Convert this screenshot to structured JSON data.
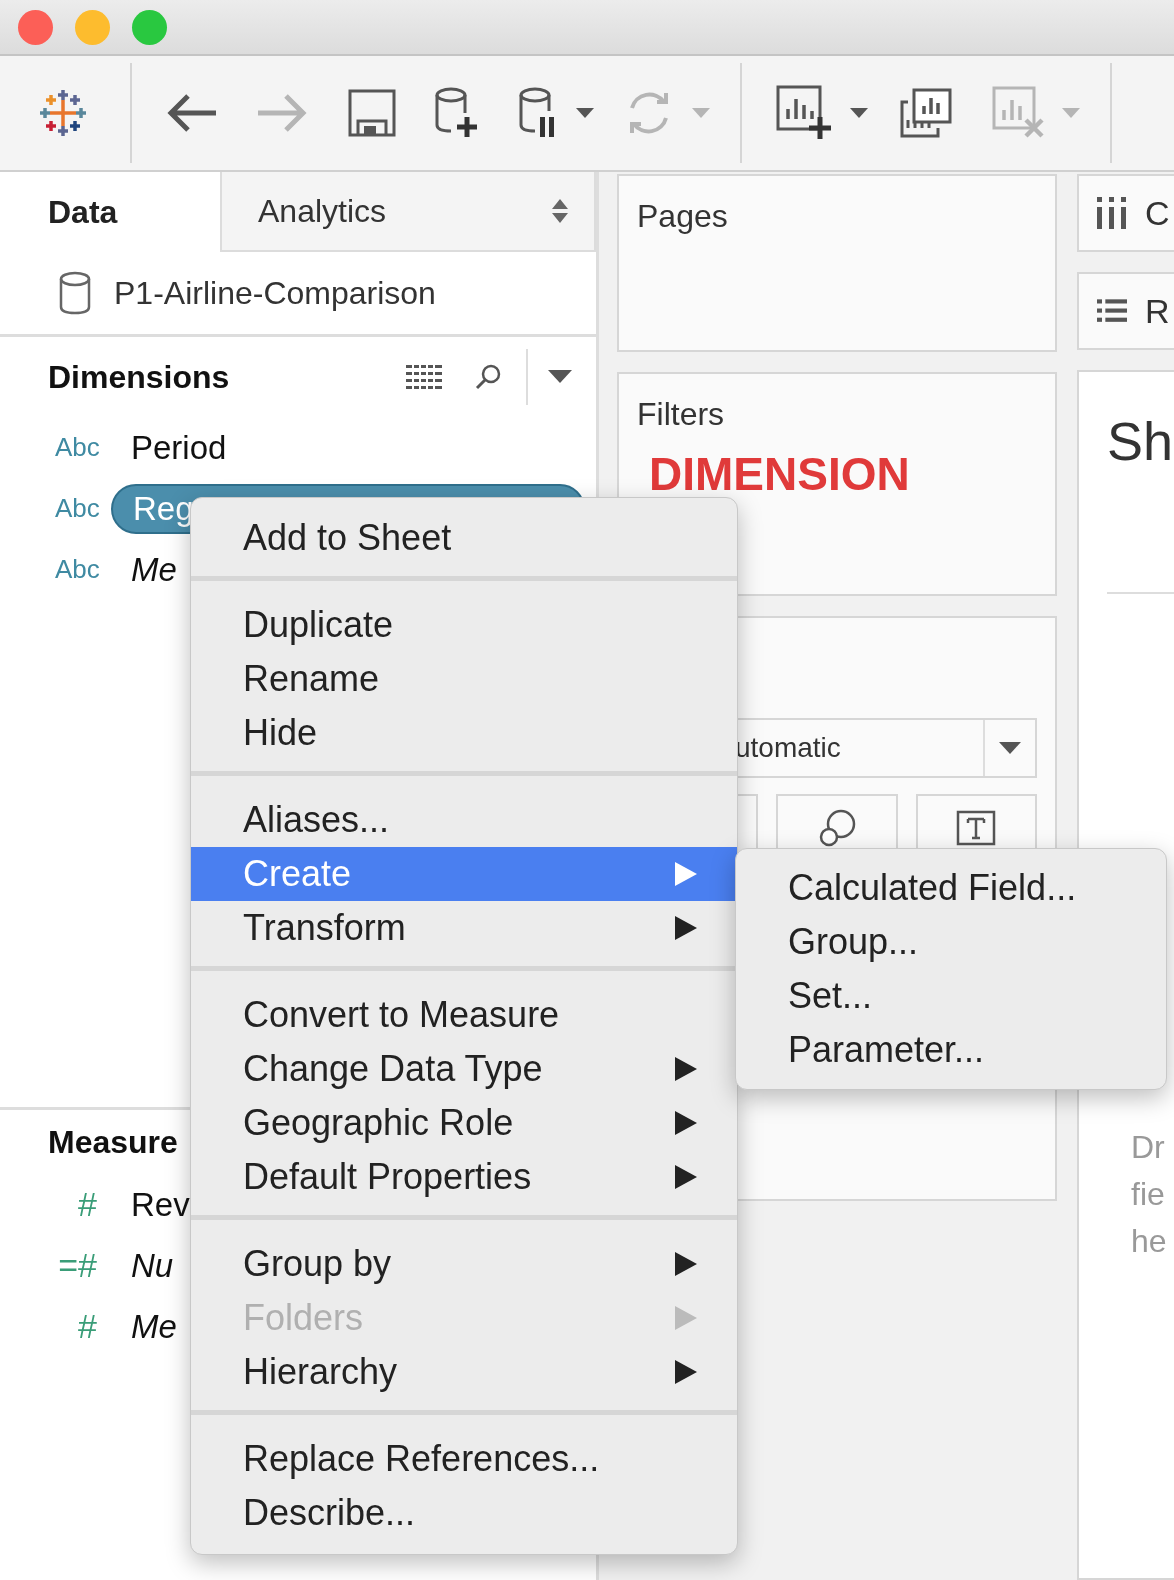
{
  "toolbar": [
    {
      "kind": "logo"
    },
    {
      "kind": "divider"
    },
    {
      "kind": "back",
      "disabled": false
    },
    {
      "kind": "forward",
      "disabled": true
    },
    {
      "kind": "save",
      "disabled": false
    },
    {
      "kind": "new-source",
      "disabled": false
    },
    {
      "kind": "pause-source",
      "disabled": false
    },
    {
      "kind": "caret",
      "disabled": false
    },
    {
      "kind": "refresh",
      "disabled": true
    },
    {
      "kind": "caret",
      "disabled": true
    },
    {
      "kind": "divider"
    },
    {
      "kind": "new-sheet",
      "disabled": false
    },
    {
      "kind": "caret",
      "disabled": false
    },
    {
      "kind": "duplicate-sheet",
      "disabled": false
    },
    {
      "kind": "clear-sheet",
      "disabled": true
    },
    {
      "kind": "caret",
      "disabled": true
    },
    {
      "kind": "divider"
    }
  ],
  "tabs": [
    {
      "label": "Data",
      "selected": true
    },
    {
      "label": "Analytics",
      "selected": false
    }
  ],
  "data_source": "P1-Airline-Comparison",
  "dimensions": {
    "title": "Dimensions",
    "fields": [
      {
        "type_label": "Abc",
        "kind": "text",
        "name": "Period",
        "italic": false,
        "selected": false
      },
      {
        "type_label": "Abc",
        "kind": "text",
        "name": "Reg",
        "italic": false,
        "selected": true
      },
      {
        "type_label": "Abc",
        "kind": "text",
        "name": "Me",
        "italic": true,
        "selected": false
      }
    ]
  },
  "measures": {
    "title": "Measure",
    "fields": [
      {
        "type_label": "#",
        "kind": "number",
        "name": "Rev",
        "italic": false,
        "selected": false
      },
      {
        "type_label": "=#",
        "kind": "number",
        "name": "Nu",
        "italic": true,
        "selected": false
      },
      {
        "type_label": "#",
        "kind": "number",
        "name": "Me",
        "italic": true,
        "selected": false
      }
    ]
  },
  "shelves": {
    "pages": "Pages",
    "filters": "Filters",
    "annotation": "DIMENSION",
    "mark_type": "utomatic",
    "columns": "C",
    "rows": "R"
  },
  "sheet": {
    "title": "Sh",
    "hint": [
      "Dr",
      "fie",
      "he"
    ]
  },
  "context_menu": [
    {
      "kind": "item",
      "label": "Add to Sheet",
      "submenu": false,
      "selected": false,
      "disabled": false
    },
    {
      "kind": "separator"
    },
    {
      "kind": "item",
      "label": "Duplicate",
      "submenu": false,
      "selected": false,
      "disabled": false
    },
    {
      "kind": "item",
      "label": "Rename",
      "submenu": false,
      "selected": false,
      "disabled": false
    },
    {
      "kind": "item",
      "label": "Hide",
      "submenu": false,
      "selected": false,
      "disabled": false
    },
    {
      "kind": "separator"
    },
    {
      "kind": "item",
      "label": "Aliases...",
      "submenu": false,
      "selected": false,
      "disabled": false
    },
    {
      "kind": "item",
      "label": "Create",
      "submenu": true,
      "selected": true,
      "disabled": false
    },
    {
      "kind": "item",
      "label": "Transform",
      "submenu": true,
      "selected": false,
      "disabled": false
    },
    {
      "kind": "separator"
    },
    {
      "kind": "item",
      "label": "Convert to Measure",
      "submenu": false,
      "selected": false,
      "disabled": false
    },
    {
      "kind": "item",
      "label": "Change Data Type",
      "submenu": true,
      "selected": false,
      "disabled": false
    },
    {
      "kind": "item",
      "label": "Geographic Role",
      "submenu": true,
      "selected": false,
      "disabled": false
    },
    {
      "kind": "item",
      "label": "Default Properties",
      "submenu": true,
      "selected": false,
      "disabled": false
    },
    {
      "kind": "separator"
    },
    {
      "kind": "item",
      "label": "Group by",
      "submenu": true,
      "selected": false,
      "disabled": false
    },
    {
      "kind": "item",
      "label": "Folders",
      "submenu": true,
      "selected": false,
      "disabled": true
    },
    {
      "kind": "item",
      "label": "Hierarchy",
      "submenu": true,
      "selected": false,
      "disabled": false
    },
    {
      "kind": "separator"
    },
    {
      "kind": "item",
      "label": "Replace References...",
      "submenu": false,
      "selected": false,
      "disabled": false
    },
    {
      "kind": "item",
      "label": "Describe...",
      "submenu": false,
      "selected": false,
      "disabled": false
    }
  ],
  "submenu": [
    "Calculated Field...",
    "Group...",
    "Set...",
    "Parameter..."
  ]
}
